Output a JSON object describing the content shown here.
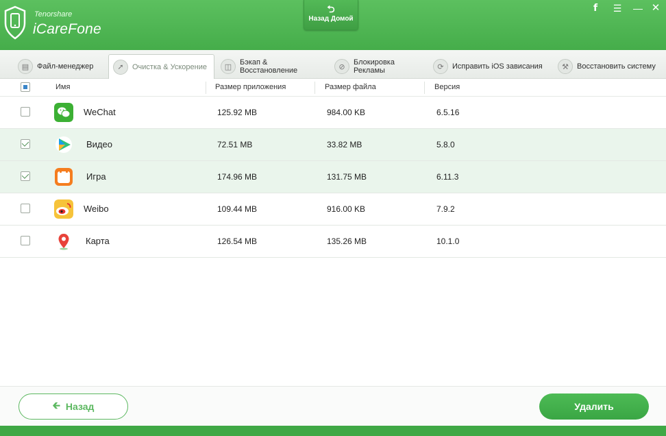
{
  "header": {
    "brand_small": "Tenorshare",
    "brand_name": "iCareFone",
    "home_label": "Назад Домой",
    "home_icon": "home-return-icon",
    "window_controls": [
      "facebook-icon",
      "menu-icon",
      "minimize-icon",
      "close-icon"
    ],
    "accent_color": "#4cb151"
  },
  "tabs": [
    {
      "label": "Файл-менеджер",
      "icon": "file-manager-icon"
    },
    {
      "label": "Очистка & Ускорение",
      "icon": "rocket-icon",
      "active": true
    },
    {
      "label": "Бэкап & Восстановление",
      "icon": "backup-icon"
    },
    {
      "label": "Блокировка Рекламы",
      "icon": "ad-block-icon"
    },
    {
      "label": "Исправить iOS зависания",
      "icon": "refresh-icon"
    },
    {
      "label": "Восстановить систему",
      "icon": "wrench-icon"
    }
  ],
  "table": {
    "columns": [
      "Имя",
      "Размер приложения",
      "Размер файла",
      "Версия"
    ],
    "rows": [
      {
        "name": "WeChat",
        "app_size": "125.92 MB",
        "file_size": "984.00 KB",
        "version": "6.5.16",
        "checked": false,
        "icon": "wechat-icon"
      },
      {
        "name": "Видео",
        "app_size": "72.51 MB",
        "file_size": "33.82 MB",
        "version": "5.8.0",
        "checked": true,
        "icon": "video-app-icon"
      },
      {
        "name": "Игра",
        "app_size": "174.96 MB",
        "file_size": "131.75 MB",
        "version": "6.11.3",
        "checked": true,
        "icon": "game-app-icon"
      },
      {
        "name": "Weibo",
        "app_size": "109.44 MB",
        "file_size": "916.00 KB",
        "version": "7.9.2",
        "checked": false,
        "icon": "weibo-icon"
      },
      {
        "name": "Карта",
        "app_size": "126.54 MB",
        "file_size": "135.26 MB",
        "version": "10.1.0",
        "checked": false,
        "icon": "map-app-icon"
      }
    ]
  },
  "footer": {
    "back_label": "Назад",
    "back_icon": "arrow-left-icon",
    "delete_label": "Удалить"
  }
}
